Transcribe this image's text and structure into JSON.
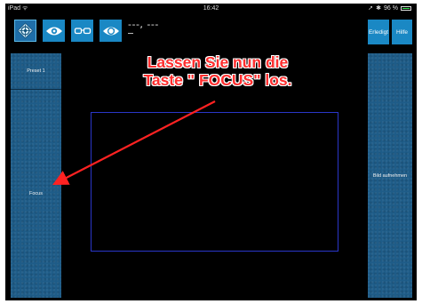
{
  "status_bar": {
    "device": "iPad ᯤ",
    "time": "16:42",
    "location_icon": "➚",
    "bluetooth_icon": "✱",
    "battery_percent_label": "96 %",
    "battery_level": 0.96
  },
  "toolbar": {
    "buttons": [
      {
        "icon": "crosshair-target-icon"
      },
      {
        "icon": "eye-icon"
      },
      {
        "icon": "glasses-icon"
      },
      {
        "icon": "eye-refresh-icon"
      }
    ],
    "readout": "---, ---",
    "readout_sub": "_",
    "done_label": "Erledigt",
    "help_label": "Hilfe"
  },
  "left_panel": {
    "preset_label": "Preset 1",
    "focus_label": "Focus"
  },
  "right_panel": {
    "capture_label": "Bild aufnehmen"
  },
  "annotation": {
    "line1": "Lassen Sie nun die",
    "line2": "Taste \" FOCUS\" los."
  },
  "colors": {
    "background": "#000000",
    "button_blue": "#1a88c4",
    "panel_blue": "#1e5c88",
    "preview_border": "#2a36c9",
    "annotation_red": "#ff2e2e"
  }
}
